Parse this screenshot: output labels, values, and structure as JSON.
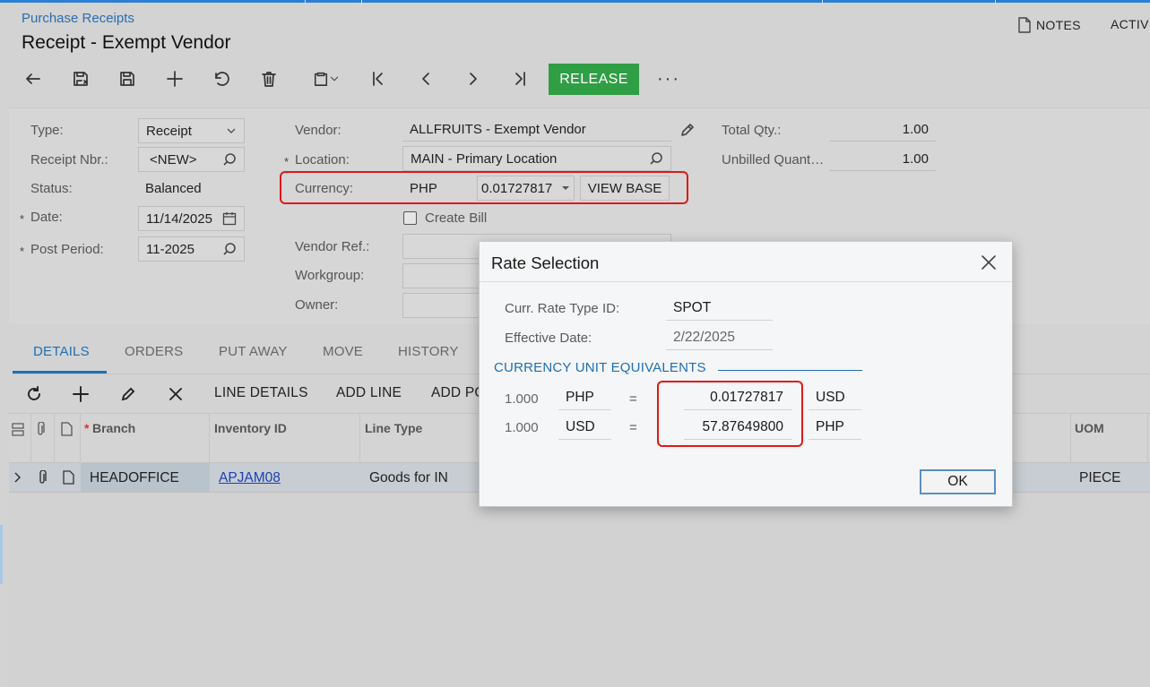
{
  "header": {
    "breadcrumb": "Purchase Receipts",
    "title": "Receipt - Exempt Vendor",
    "notes_label": "NOTES",
    "activities_label": "ACTIV"
  },
  "toolbar": {
    "release_label": "RELEASE",
    "more_label": "···"
  },
  "form": {
    "type_label": "Type:",
    "type_value": "Receipt",
    "receipt_nbr_label": "Receipt Nbr.:",
    "receipt_nbr_value": "<NEW>",
    "status_label": "Status:",
    "status_value": "Balanced",
    "date_label": "Date:",
    "date_value": "11/14/2025",
    "post_period_label": "Post Period:",
    "post_period_value": "11-2025",
    "vendor_label": "Vendor:",
    "vendor_value": "ALLFRUITS - Exempt Vendor",
    "location_label": "Location:",
    "location_value": "MAIN - Primary Location",
    "currency_label": "Currency:",
    "currency_value": "PHP",
    "currency_rate": "0.01727817",
    "view_base_label": "VIEW BASE",
    "create_bill_label": "Create Bill",
    "create_bill_checked": false,
    "vendor_ref_label": "Vendor Ref.:",
    "workgroup_label": "Workgroup:",
    "owner_label": "Owner:",
    "total_qty_label": "Total Qty.:",
    "total_qty_value": "1.00",
    "unbilled_qty_label": "Unbilled Quant…",
    "unbilled_qty_value": "1.00",
    "required_marker": "*"
  },
  "tabs": [
    "DETAILS",
    "ORDERS",
    "PUT AWAY",
    "MOVE",
    "HISTORY"
  ],
  "grid_toolbar": {
    "line_details": "LINE DETAILS",
    "add_line": "ADD LINE",
    "add_po": "ADD PO"
  },
  "grid": {
    "columns": {
      "branch": "Branch",
      "inventory_id": "Inventory ID",
      "line_type": "Line Type",
      "uom": "UOM"
    },
    "rows": [
      {
        "branch": "HEADOFFICE",
        "inventory_id": "APJAM08",
        "line_type": "Goods for IN",
        "uom": "PIECE"
      }
    ]
  },
  "modal": {
    "title": "Rate Selection",
    "rate_type_label": "Curr. Rate Type ID:",
    "rate_type_value": "SPOT",
    "effective_date_label": "Effective Date:",
    "effective_date_value": "2/22/2025",
    "section_title": "CURRENCY UNIT EQUIVALENTS",
    "equivalents": [
      {
        "qty": "1.000",
        "from": "PHP",
        "eq": "=",
        "rate": "0.01727817",
        "to": "USD"
      },
      {
        "qty": "1.000",
        "from": "USD",
        "eq": "=",
        "rate": "57.87649800",
        "to": "PHP"
      }
    ],
    "ok_label": "OK"
  },
  "colors": {
    "accent": "#1f6fb3",
    "release": "#2f9e44",
    "highlight": "#e01818"
  }
}
